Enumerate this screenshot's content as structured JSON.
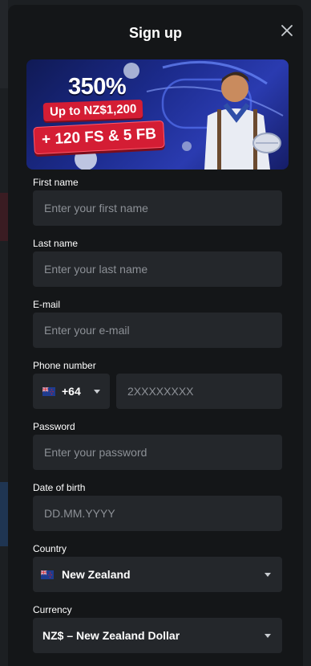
{
  "modal": {
    "title": "Sign up"
  },
  "banner": {
    "percent": "350%",
    "up_to": "Up to NZ$1,200",
    "extras": "+ 120 FS & 5 FB"
  },
  "form": {
    "first_name": {
      "label": "First name",
      "placeholder": "Enter your first name"
    },
    "last_name": {
      "label": "Last name",
      "placeholder": "Enter your last name"
    },
    "email": {
      "label": "E-mail",
      "placeholder": "Enter your e-mail"
    },
    "phone": {
      "label": "Phone number",
      "code": "+64",
      "placeholder": "2XXXXXXXX"
    },
    "password": {
      "label": "Password",
      "placeholder": "Enter your password"
    },
    "dob": {
      "label": "Date of birth",
      "placeholder": "DD.MM.YYYY"
    },
    "country": {
      "label": "Country",
      "value": "New Zealand"
    },
    "currency": {
      "label": "Currency",
      "value": "NZ$ – New Zealand Dollar"
    }
  },
  "icons": {
    "close": "close-icon",
    "flag": "nz-flag-icon",
    "caret": "chevron-down-icon"
  },
  "colors": {
    "modal_bg": "#141618",
    "input_bg": "#24272b",
    "badge_red": "#d41d34",
    "banner_blue": "#1b2a8a"
  }
}
